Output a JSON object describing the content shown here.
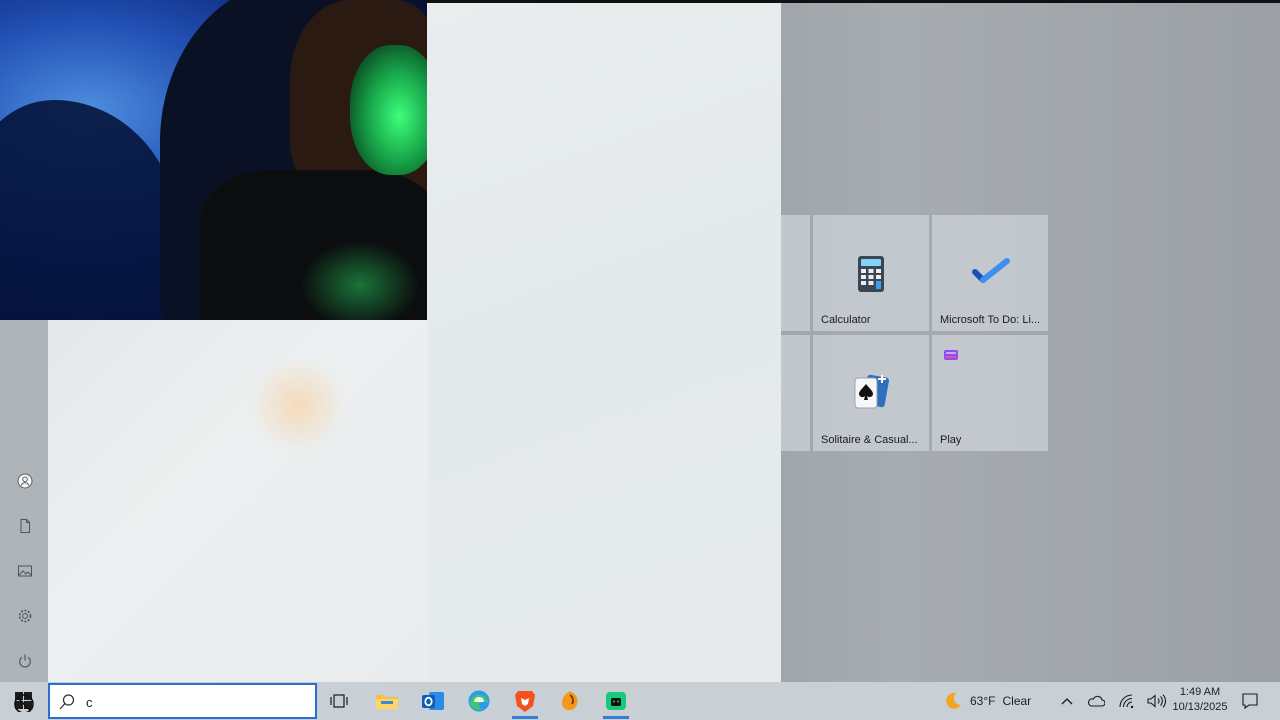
{
  "tiles": [
    {
      "label": "Calculator",
      "icon": "calculator-icon"
    },
    {
      "label": "Microsoft To Do: Li...",
      "icon": "todo-check-icon"
    },
    {
      "label": "Solitaire & Casual...",
      "icon": "solitaire-icon"
    },
    {
      "label": "Play",
      "icon": "play-folder-icon"
    }
  ],
  "rail": [
    "user-icon",
    "documents-icon",
    "pictures-icon",
    "settings-icon",
    "power-icon"
  ],
  "search": {
    "value": "c",
    "placeholder": ""
  },
  "taskbar": {
    "apps": [
      "task-view-icon",
      "file-explorer-icon",
      "outlook-icon",
      "edge-icon",
      "brave-icon",
      "fl-studio-icon",
      "android-app-icon"
    ]
  },
  "tray": {
    "weather_temp": "63°F",
    "weather_text": "Clear",
    "time": "1:49 AM",
    "date": "10/13/2025"
  },
  "colors": {
    "accent": "#2a6fcf",
    "taskbar": "#c8d0d5"
  }
}
